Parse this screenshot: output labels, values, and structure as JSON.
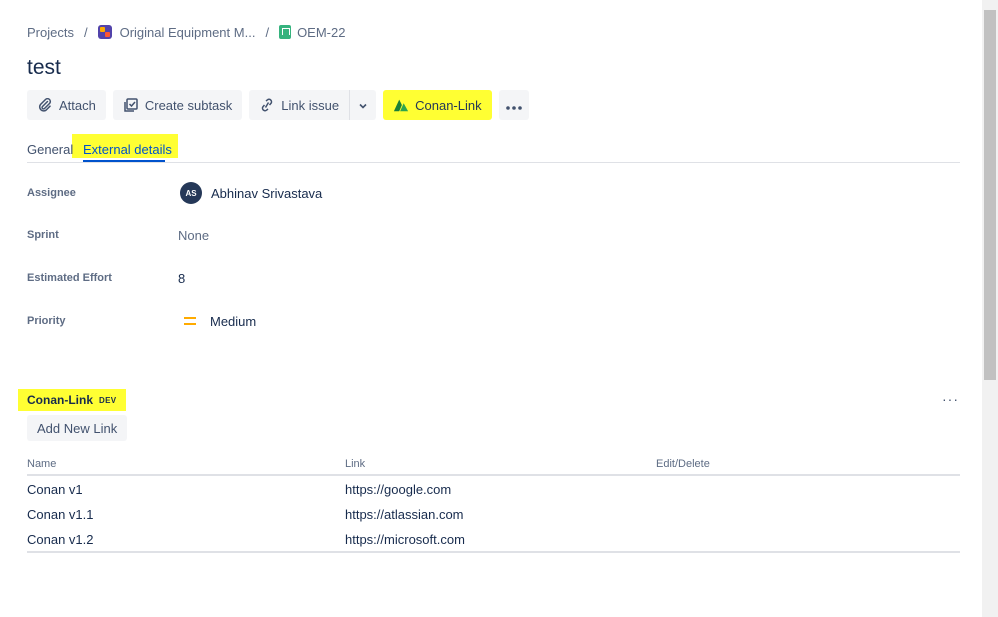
{
  "breadcrumb": {
    "projects": "Projects",
    "project_name": "Original Equipment M...",
    "issue_key": "OEM-22",
    "separator": "/"
  },
  "issue": {
    "title": "test"
  },
  "toolbar": {
    "attach": "Attach",
    "create_subtask": "Create subtask",
    "link_issue": "Link issue",
    "conan_link": "Conan-Link"
  },
  "tabs": {
    "general": "General",
    "external_details": "External details"
  },
  "fields": {
    "assignee_label": "Assignee",
    "assignee_initials": "AS",
    "assignee_name": "Abhinav Srivastava",
    "sprint_label": "Sprint",
    "sprint_value": "None",
    "effort_label": "Estimated Effort",
    "effort_value": "8",
    "priority_label": "Priority",
    "priority_value": "Medium"
  },
  "conan_section": {
    "title": "Conan-Link",
    "badge": "DEV",
    "more": "···",
    "add_button": "Add New Link",
    "columns": [
      "Name",
      "Link",
      "Edit/Delete"
    ],
    "rows": [
      {
        "name": "Conan v1",
        "link": "https://google.com"
      },
      {
        "name": "Conan v1.1",
        "link": "https://atlassian.com"
      },
      {
        "name": "Conan v1.2",
        "link": "https://microsoft.com"
      }
    ]
  },
  "colors": {
    "highlight": "#ffff33",
    "link_blue": "#0052cc",
    "priority_medium": "#ffab00",
    "conan_green": "#36b37e"
  }
}
